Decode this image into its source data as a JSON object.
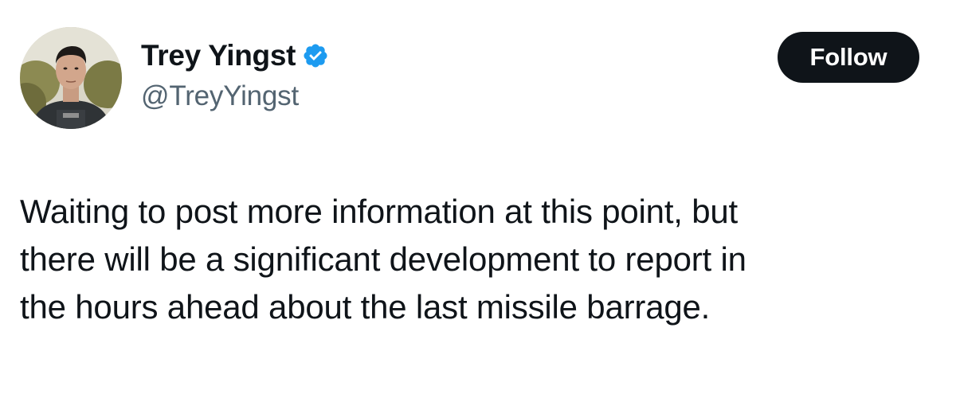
{
  "author": {
    "display_name": "Trey Yingst",
    "handle": "@TreyYingst",
    "verified_icon": "verified-badge-icon"
  },
  "actions": {
    "follow_label": "Follow"
  },
  "post": {
    "lines": [
      "Waiting to post more information at this point, but",
      "there will be a significant development to report in",
      "the hours ahead about the last missile barrage."
    ]
  },
  "colors": {
    "text_primary": "#0f1419",
    "text_secondary": "#536471",
    "verified_blue": "#1d9bf0",
    "follow_bg": "#0f1419",
    "follow_text": "#ffffff",
    "background": "#ffffff"
  }
}
